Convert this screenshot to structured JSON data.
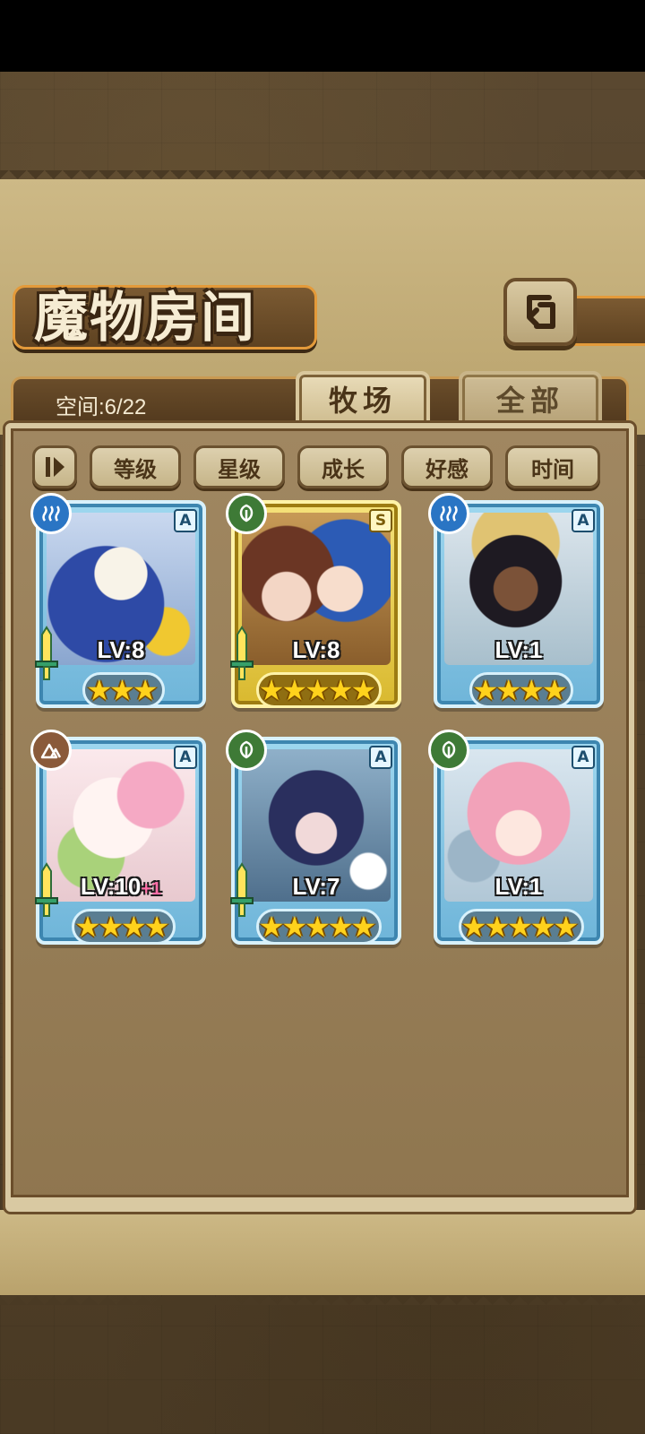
{
  "header": {
    "title": "魔物房间"
  },
  "status": {
    "space_label": "空间:6/22"
  },
  "tabs": [
    {
      "label": "牧场",
      "active": true
    },
    {
      "label": "全部",
      "active": false
    }
  ],
  "sort_buttons": [
    {
      "label": "等级"
    },
    {
      "label": "星级"
    },
    {
      "label": "成长"
    },
    {
      "label": "好感"
    },
    {
      "label": "时间"
    }
  ],
  "monsters": [
    {
      "element": "water",
      "rank": "A",
      "level": "LV:8",
      "level_bonus": "",
      "stars": 3,
      "stars_text": "★★★"
    },
    {
      "element": "grass",
      "rank": "S",
      "level": "LV:8",
      "level_bonus": "",
      "stars": 5,
      "stars_text": "★★★★★"
    },
    {
      "element": "water",
      "rank": "A",
      "level": "LV:1",
      "level_bonus": "",
      "stars": 4,
      "stars_text": "★★★★"
    },
    {
      "element": "earth",
      "rank": "A",
      "level": "LV:10",
      "level_bonus": "+1",
      "stars": 4,
      "stars_text": "★★★★"
    },
    {
      "element": "grass",
      "rank": "A",
      "level": "LV:7",
      "level_bonus": "",
      "stars": 5,
      "stars_text": "★★★★★"
    },
    {
      "element": "grass",
      "rank": "A",
      "level": "LV:1",
      "level_bonus": "",
      "stars": 5,
      "stars_text": "★★★★★"
    }
  ],
  "colors": {
    "water_element": "#2a75c4",
    "grass_element": "#3e7a36",
    "earth_element": "#8a5a3a",
    "rank_a_frame": "#6fb5d9",
    "rank_s_frame": "#d9b92f",
    "accent_orange": "#e39a3a",
    "star_gold": "#ffd21c"
  }
}
